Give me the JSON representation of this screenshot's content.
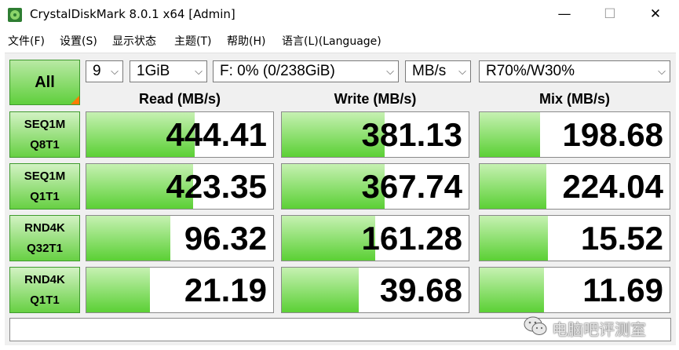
{
  "window": {
    "title": "CrystalDiskMark 8.0.1 x64 [Admin]",
    "min_glyph": "—",
    "max_glyph": "☐",
    "close_glyph": "✕"
  },
  "menu": {
    "items": [
      "文件(F)",
      "设置(S)",
      "显示状态",
      "主题(T)",
      "帮助(H)",
      "语言(L)(Language)"
    ]
  },
  "toolbar": {
    "all_label": "All",
    "count_value": "9",
    "size_value": "1GiB",
    "drive_value": "F: 0% (0/238GiB)",
    "unit_value": "MB/s",
    "profile_value": "R70%/W30%"
  },
  "headers": {
    "read": "Read (MB/s)",
    "write": "Write (MB/s)",
    "mix": "Mix (MB/s)"
  },
  "tests": [
    {
      "line1": "SEQ1M",
      "line2": "Q8T1",
      "read": "444.41",
      "write": "381.13",
      "mix": "198.68",
      "read_fill": 0.58,
      "write_fill": 0.55,
      "mix_fill": 0.32
    },
    {
      "line1": "SEQ1M",
      "line2": "Q1T1",
      "read": "423.35",
      "write": "367.74",
      "mix": "224.04",
      "read_fill": 0.57,
      "write_fill": 0.55,
      "mix_fill": 0.35
    },
    {
      "line1": "RND4K",
      "line2": "Q32T1",
      "read": "96.32",
      "write": "161.28",
      "mix": "15.52",
      "read_fill": 0.45,
      "write_fill": 0.5,
      "mix_fill": 0.36
    },
    {
      "line1": "RND4K",
      "line2": "Q1T1",
      "read": "21.19",
      "write": "39.68",
      "mix": "11.69",
      "read_fill": 0.34,
      "write_fill": 0.41,
      "mix_fill": 0.34
    }
  ],
  "comment": "",
  "watermark": {
    "text": "电脑吧评测室",
    "icon": "wechat-logo"
  },
  "colors": {
    "bar_green": "#5bd035",
    "accent_orange": "#ff7b00"
  }
}
